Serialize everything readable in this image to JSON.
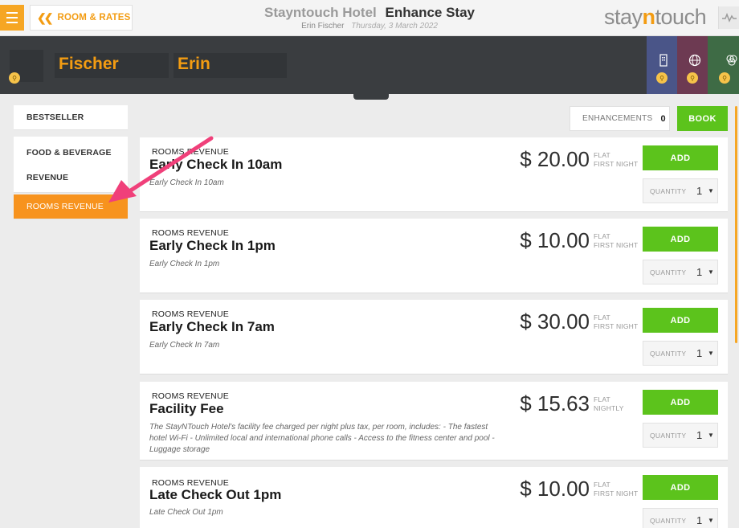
{
  "header": {
    "back_label": "ROOM & RATES",
    "hotel_name": "Stayntouch Hotel",
    "page_title": "Enhance Stay",
    "guest_name": "Erin Fischer",
    "date": "Thursday, 3 March 2022",
    "brand_pre": "stay",
    "brand_n": "n",
    "brand_post": "touch"
  },
  "guest": {
    "last_name": "Fischer",
    "first_name": "Erin"
  },
  "tiles": [
    {
      "color": "#4a5588",
      "icon": "building-icon"
    },
    {
      "color": "#6d3a52",
      "icon": "globe-icon"
    },
    {
      "color": "#3e6b45",
      "icon": "circles-icon"
    }
  ],
  "sidebar": {
    "items": [
      {
        "label": "BESTSELLER"
      },
      {
        "label_line1": "FOOD & BEVERAGE",
        "label_line2": "REVENUE"
      },
      {
        "label": "ROOMS REVENUE",
        "active": true
      }
    ]
  },
  "summary": {
    "enhancements_label": "ENHANCEMENTS",
    "enhancements_count": "0",
    "book_label": "BOOK"
  },
  "items": [
    {
      "category": "ROOMS REVENUE",
      "name": "Early Check In 10am",
      "description": "Early Check In 10am",
      "price": "$ 20.00",
      "type1": "FLAT",
      "type2": "FIRST NIGHT",
      "add_label": "ADD",
      "qty_label": "QUANTITY",
      "qty_value": "1"
    },
    {
      "category": "ROOMS REVENUE",
      "name": "Early Check In 1pm",
      "description": "Early Check In 1pm",
      "price": "$ 10.00",
      "type1": "FLAT",
      "type2": "FIRST NIGHT",
      "add_label": "ADD",
      "qty_label": "QUANTITY",
      "qty_value": "1"
    },
    {
      "category": "ROOMS REVENUE",
      "name": "Early Check In 7am",
      "description": "Early Check In 7am",
      "price": "$ 30.00",
      "type1": "FLAT",
      "type2": "FIRST NIGHT",
      "add_label": "ADD",
      "qty_label": "QUANTITY",
      "qty_value": "1"
    },
    {
      "category": "ROOMS REVENUE",
      "name": "Facility Fee",
      "description": "The StayNTouch Hotel's facility fee charged per night plus tax, per room, includes: - The fastest hotel Wi-Fi - Unlimited local and international phone calls - Access to the fitness center and pool - Luggage storage",
      "price": "$ 15.63",
      "type1": "FLAT",
      "type2": "NIGHTLY",
      "add_label": "ADD",
      "qty_label": "QUANTITY",
      "qty_value": "1"
    },
    {
      "category": "ROOMS REVENUE",
      "name": "Late Check Out 1pm",
      "description": "Late Check Out 1pm",
      "price": "$ 10.00",
      "type1": "FLAT",
      "type2": "FIRST NIGHT",
      "add_label": "ADD",
      "qty_label": "QUANTITY",
      "qty_value": "1"
    }
  ],
  "colors": {
    "accent_orange": "#f39c12",
    "button_green": "#5cc31c",
    "annotation_arrow": "#f0407a"
  }
}
